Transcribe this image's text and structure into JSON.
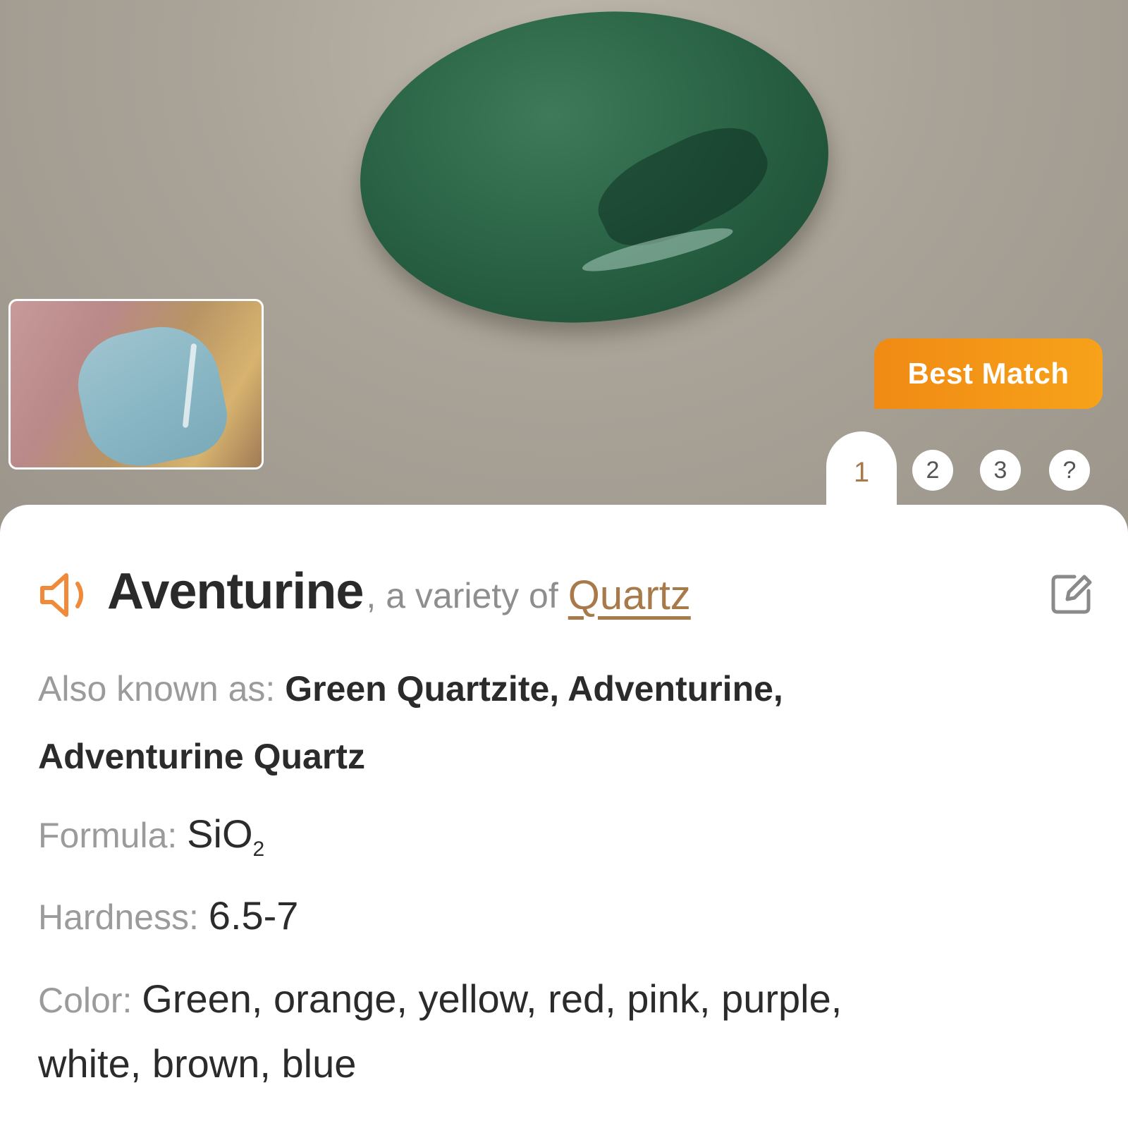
{
  "match_tag": {
    "label": "Best Match"
  },
  "tabs": [
    {
      "label": "1",
      "active": true
    },
    {
      "label": "2",
      "active": false
    },
    {
      "label": "3",
      "active": false
    },
    {
      "label": "?",
      "active": false
    }
  ],
  "result": {
    "name": "Aventurine",
    "variety_text": ", a variety of",
    "parent_link": "Quartz",
    "also_known_as_label": "Also known as:",
    "also_known_as_line1": "Green Quartzite, Adventurine,",
    "also_known_as_line2": "Adventurine Quartz",
    "formula_label": "Formula:",
    "formula_main": "SiO",
    "formula_sub": "2",
    "hardness_label": "Hardness:",
    "hardness_value": "6.5-7",
    "color_label": "Color:",
    "color_line1": "Green, orange, yellow, red, pink, purple,",
    "color_line2": "white, brown, blue"
  },
  "colors": {
    "accent": "#f39a18",
    "link": "#a87a4a",
    "label_gray": "#9b9b9b",
    "speaker": "#f08a3a"
  },
  "icons": {
    "speaker": "speaker-icon",
    "edit": "edit-icon"
  }
}
